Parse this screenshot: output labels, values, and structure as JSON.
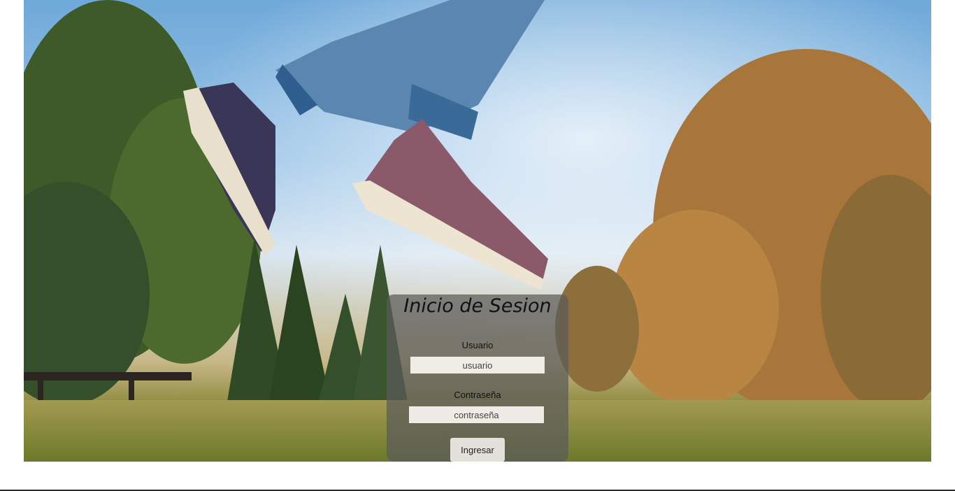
{
  "login": {
    "title": "Inicio de Sesion",
    "username_label": "Usuario",
    "username_placeholder": "usuario",
    "password_label": "Contraseña",
    "password_placeholder": "contraseña",
    "submit_label": "Ingresar"
  }
}
